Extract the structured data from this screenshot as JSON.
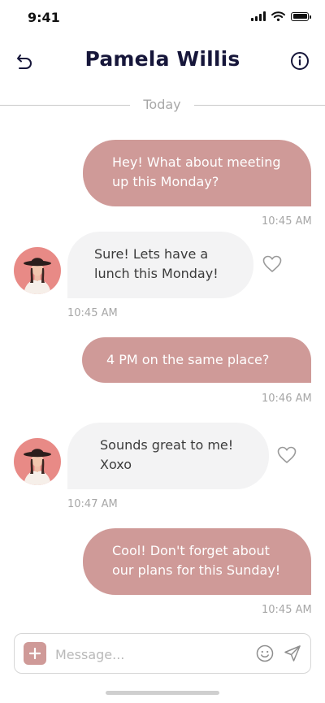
{
  "status_bar": {
    "time": "9:41"
  },
  "header": {
    "contact_name": "Pamela Willis"
  },
  "date_divider": "Today",
  "messages": [
    {
      "direction": "outgoing",
      "lines": [
        "Hey! What about meeting",
        "up this Monday?"
      ],
      "time": "10:45 AM"
    },
    {
      "direction": "incoming",
      "lines": [
        "Sure! Lets have a",
        "lunch this Monday!"
      ],
      "time": "10:45 AM"
    },
    {
      "direction": "outgoing",
      "lines": [
        "4 PM on the same place?"
      ],
      "time": "10:46 AM"
    },
    {
      "direction": "incoming",
      "lines": [
        "Sounds great to me!",
        "Xoxo"
      ],
      "time": "10:47 AM"
    },
    {
      "direction": "outgoing",
      "lines": [
        "Cool! Don't forget about",
        "our plans for this Sunday!"
      ],
      "time": "10:45 AM"
    }
  ],
  "composer": {
    "placeholder": "Message..."
  },
  "colors": {
    "accent": "#cf9a98",
    "incoming_bubble": "#f3f3f4",
    "title": "#16163a",
    "muted_text": "#a7a7a7"
  },
  "icons": {
    "back": "undo-arrow-icon",
    "info": "info-circle-icon",
    "like": "heart-outline-icon",
    "add": "plus-icon",
    "emoji": "smiley-icon",
    "send": "paper-plane-icon"
  }
}
